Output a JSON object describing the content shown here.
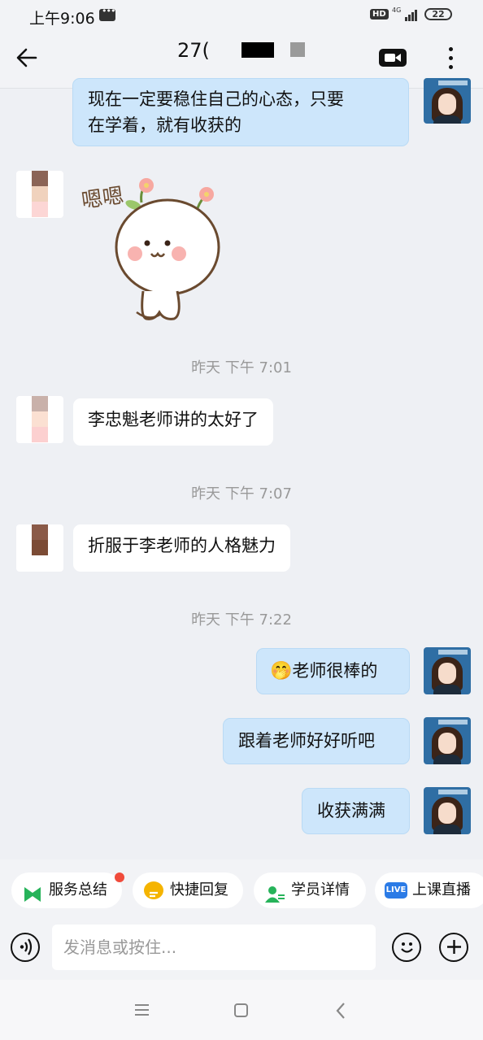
{
  "status_bar": {
    "time": "上午9:06",
    "hd": "HD",
    "network": "4G",
    "battery": "22"
  },
  "header": {
    "title": "27("
  },
  "messages": [
    {
      "side": "out",
      "text_line1": "现在一定要稳住自己的心态，只要",
      "text_line2": "在学着，就有收获的"
    },
    {
      "side": "in",
      "type": "sticker",
      "sticker_text": "嗯嗯"
    },
    {
      "timestamp": "昨天  下午 7:01"
    },
    {
      "side": "in",
      "text": "李忠魁老师讲的太好了"
    },
    {
      "timestamp": "昨天  下午 7:07"
    },
    {
      "side": "in",
      "text": "折服于李老师的人格魅力"
    },
    {
      "timestamp": "昨天  下午 7:22"
    },
    {
      "side": "out",
      "text": "老师很棒的",
      "emoji": "🤭"
    },
    {
      "side": "out",
      "text": "跟着老师好好听吧"
    },
    {
      "side": "out",
      "text": "收获满满"
    }
  ],
  "shortcuts": [
    {
      "label": "服务总结",
      "icon": "service-summary-icon",
      "badge": true
    },
    {
      "label": "快捷回复",
      "icon": "quick-reply-icon"
    },
    {
      "label": "学员详情",
      "icon": "student-detail-icon"
    },
    {
      "label": "上课直播",
      "icon": "live-icon",
      "icon_text": "LIVE"
    }
  ],
  "input": {
    "placeholder": "发消息或按住..."
  },
  "colors": {
    "background": "#eef0f4",
    "outgoing_bubble": "#cde6fb",
    "incoming_bubble": "#ffffff",
    "badge": "#f04b3b"
  }
}
